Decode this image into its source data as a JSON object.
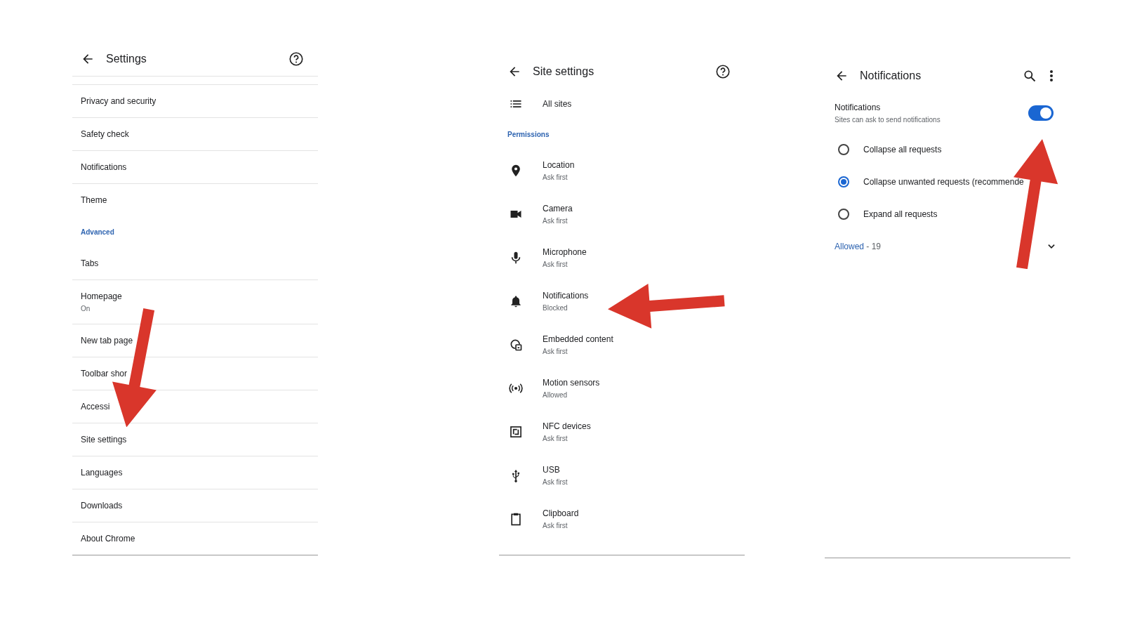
{
  "settings": {
    "title": "Settings",
    "items": [
      {
        "kind": "item",
        "label": "Privacy and security"
      },
      {
        "kind": "item",
        "label": "Safety check"
      },
      {
        "kind": "item",
        "label": "Notifications"
      },
      {
        "kind": "item",
        "label": "Theme"
      },
      {
        "kind": "section",
        "label": "Advanced"
      },
      {
        "kind": "item",
        "label": "Tabs"
      },
      {
        "kind": "item",
        "label": "Homepage",
        "subtitle": "On"
      },
      {
        "kind": "item",
        "label": "New tab page"
      },
      {
        "kind": "item",
        "label": "Toolbar shor"
      },
      {
        "kind": "item",
        "label": "Accessi"
      },
      {
        "kind": "item",
        "label": "Site settings"
      },
      {
        "kind": "item",
        "label": "Languages"
      },
      {
        "kind": "item",
        "label": "Downloads"
      },
      {
        "kind": "item",
        "label": "About Chrome"
      }
    ]
  },
  "site_settings": {
    "title": "Site settings",
    "all_sites": "All sites",
    "section": "Permissions",
    "permissions": [
      {
        "label": "Location",
        "status": "Ask first"
      },
      {
        "label": "Camera",
        "status": "Ask first"
      },
      {
        "label": "Microphone",
        "status": "Ask first"
      },
      {
        "label": "Notifications",
        "status": "Blocked"
      },
      {
        "label": "Embedded content",
        "status": "Ask first"
      },
      {
        "label": "Motion sensors",
        "status": "Allowed"
      },
      {
        "label": "NFC devices",
        "status": "Ask first"
      },
      {
        "label": "USB",
        "status": "Ask first"
      },
      {
        "label": "Clipboard",
        "status": "Ask first"
      }
    ]
  },
  "notifications": {
    "title": "Notifications",
    "toggle": {
      "label": "Notifications",
      "description": "Sites can ask to send notifications",
      "on": true
    },
    "options": [
      {
        "label": "Collapse all requests",
        "selected": false
      },
      {
        "label": "Collapse unwanted requests (recommende",
        "selected": true
      },
      {
        "label": "Expand all requests",
        "selected": false
      }
    ],
    "allowed": {
      "label": "Allowed",
      "count": " - 19"
    }
  }
}
